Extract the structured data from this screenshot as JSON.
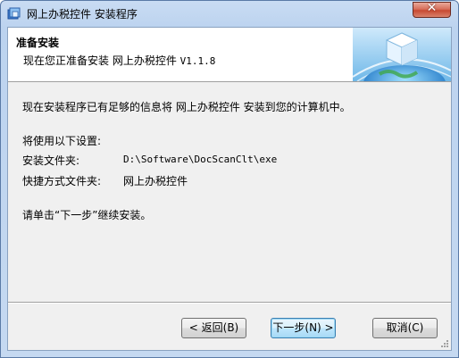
{
  "window": {
    "title": "网上办税控件 安装程序",
    "close_glyph": "✕"
  },
  "header": {
    "title": "准备安装",
    "subtitle_prefix": "现在您正准备安装 网上办税控件 ",
    "version": "V1.1.8"
  },
  "body": {
    "intro": "现在安装程序已有足够的信息将 网上办税控件 安装到您的计算机中。",
    "settings_heading": "将使用以下设置:",
    "install_folder_label": "安装文件夹:",
    "install_folder_value": "D:\\Software\\DocScanClt\\exe",
    "shortcut_folder_label": "快捷方式文件夹:",
    "shortcut_folder_value": "网上办税控件",
    "instruction": "请单击“下一步”继续安装。"
  },
  "buttons": {
    "back": "< 返回(B)",
    "next": "下一步(N) >",
    "cancel": "取消(C)"
  },
  "icons": {
    "app": "installer-box-icon",
    "header_art": "cube-on-globe-icon"
  }
}
